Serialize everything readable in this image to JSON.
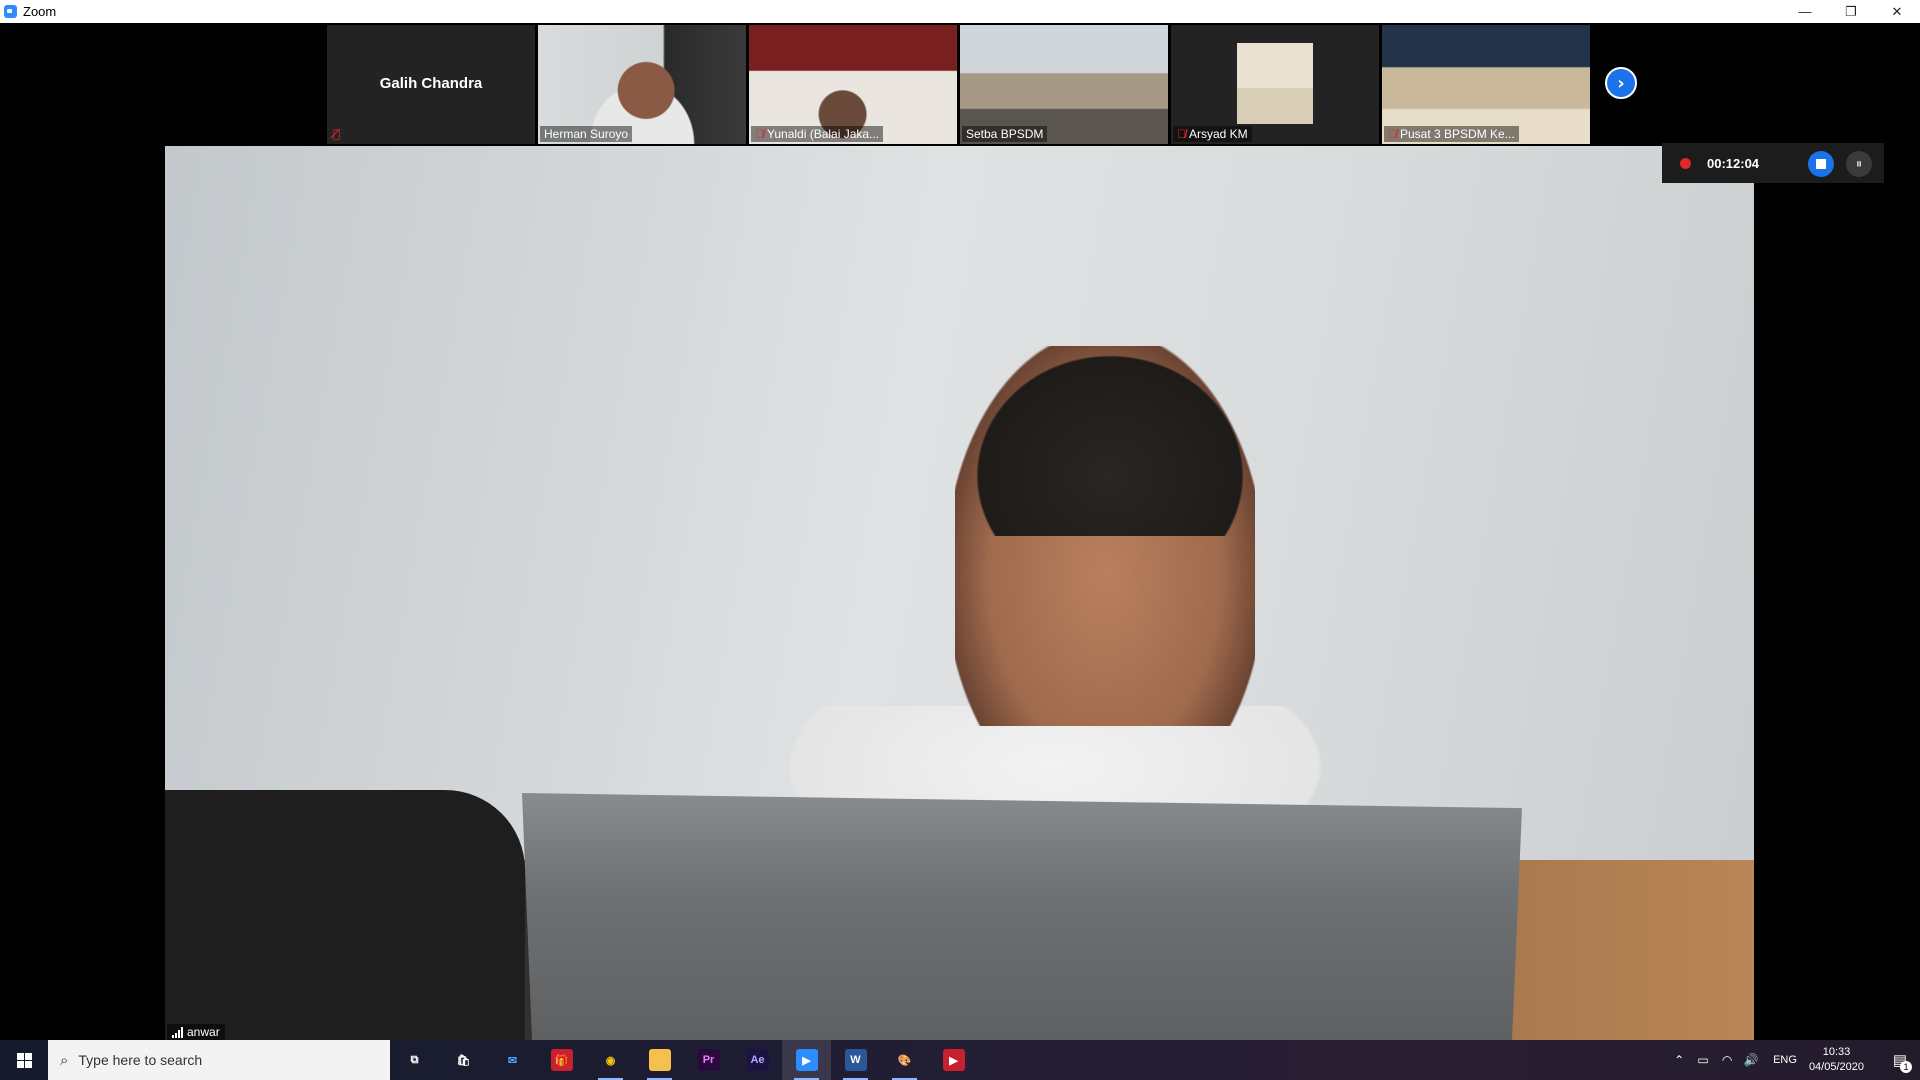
{
  "window": {
    "title": "Zoom",
    "minimize_glyph": "—",
    "restore_glyph": "❐",
    "close_glyph": "✕"
  },
  "participants": [
    {
      "name": "Galih Chandra",
      "muted": true,
      "video": false
    },
    {
      "name": "Herman Suroyo",
      "muted": false,
      "video": true
    },
    {
      "name": "Yunaldi (Balai Jaka...",
      "muted": true,
      "video": true
    },
    {
      "name": "Setba BPSDM",
      "muted": false,
      "video": true
    },
    {
      "name": "Arsyad KM",
      "muted": true,
      "video": true
    },
    {
      "name": "Pusat 3 BPSDM Ke...",
      "muted": true,
      "video": true
    }
  ],
  "next_page_glyph": "›",
  "recording": {
    "elapsed": "00:12:04"
  },
  "main_speaker": {
    "name": "anwar"
  },
  "taskbar": {
    "search_placeholder": "Type here to search",
    "apps": [
      {
        "icon": "task-view-icon",
        "glyph": "⧉",
        "bg": "transparent",
        "color": "#ffffff"
      },
      {
        "icon": "store-icon",
        "glyph": "🛍",
        "bg": "transparent",
        "color": "#ffffff"
      },
      {
        "icon": "mail-icon",
        "glyph": "✉",
        "bg": "transparent",
        "color": "#4aa3ff"
      },
      {
        "icon": "gift-icon",
        "glyph": "🎁",
        "bg": "#c8202f",
        "color": "#ffffff"
      },
      {
        "icon": "chrome-icon",
        "glyph": "◉",
        "bg": "transparent",
        "color": "#f4c20d"
      },
      {
        "icon": "file-explorer-icon",
        "glyph": "▬",
        "bg": "#f2c14e",
        "color": "#f2c14e"
      },
      {
        "icon": "premiere-pro-icon",
        "glyph": "Pr",
        "bg": "#2a0a3a",
        "color": "#e77cff"
      },
      {
        "icon": "after-effects-icon",
        "glyph": "Ae",
        "bg": "#1a1440",
        "color": "#b8a6ff"
      },
      {
        "icon": "zoom-icon",
        "glyph": "▶",
        "bg": "#2d8cff",
        "color": "#ffffff"
      },
      {
        "icon": "word-icon",
        "glyph": "W",
        "bg": "#2b579a",
        "color": "#ffffff"
      },
      {
        "icon": "paint-icon",
        "glyph": "🎨",
        "bg": "transparent",
        "color": "#ffffff"
      },
      {
        "icon": "media-player-icon",
        "glyph": "▶",
        "bg": "#c8202f",
        "color": "#ffffff"
      }
    ],
    "tray": {
      "language": "ENG",
      "time": "10:33",
      "date": "04/05/2020",
      "notification_count": "1"
    }
  },
  "colors": {
    "accent": "#1a73e8",
    "recording_red": "#e0272b",
    "mute_red": "#e0272b"
  }
}
